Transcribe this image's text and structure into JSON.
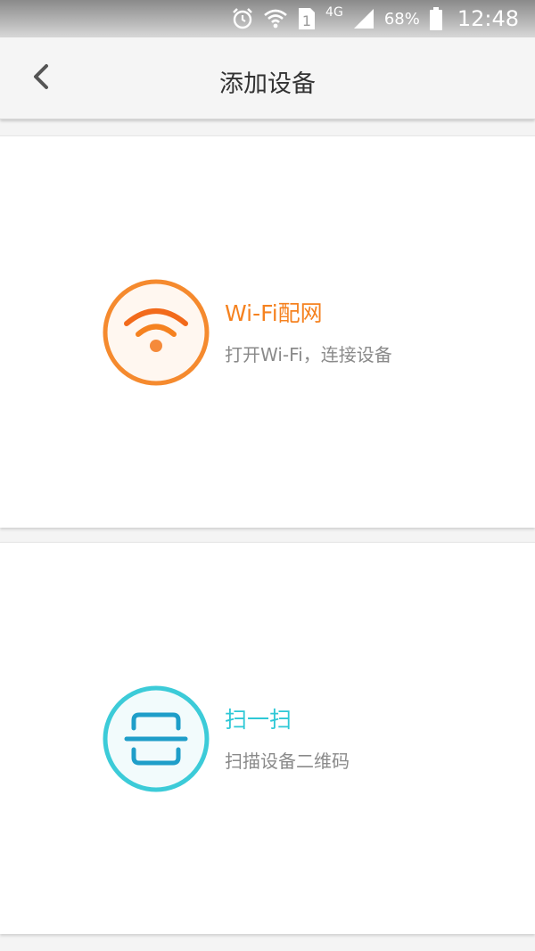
{
  "status_bar": {
    "network": "4G",
    "battery": "68%",
    "time": "12:48",
    "icons": [
      "alarm-icon",
      "wifi-signal-icon",
      "sim-icon",
      "cell-signal-icon",
      "battery-icon"
    ]
  },
  "header": {
    "back_icon": "chevron-left-icon",
    "title": "添加设备"
  },
  "options": [
    {
      "icon": "wifi-icon",
      "title": "Wi-Fi配网",
      "subtitle": "打开Wi-Fi，连接设备",
      "accent": "#f58220"
    },
    {
      "icon": "scan-icon",
      "title": "扫一扫",
      "subtitle": "扫描设备二维码",
      "accent": "#2ec8d6"
    }
  ]
}
